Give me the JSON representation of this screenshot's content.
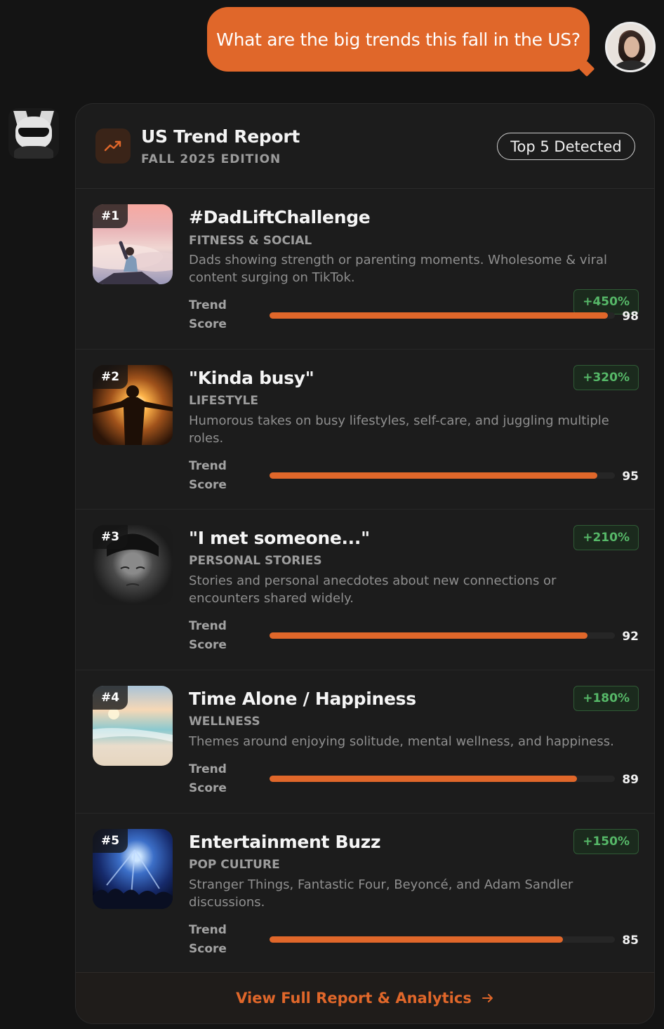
{
  "user_message": "What are the big trends this fall in the US?",
  "report": {
    "title": "US Trend Report",
    "subtitle": "FALL 2025 EDITION",
    "badge": "Top 5 Detected",
    "icon": "trending-up-icon",
    "accent_color": "#e0672a",
    "growth_color": "#56b868"
  },
  "trends": [
    {
      "rank": "#1",
      "title": "#DadLiftChallenge",
      "category": "FITNESS & SOCIAL",
      "description": "Dads showing strength or parenting moments. Wholesome & viral content surging on TikTok.",
      "growth": "+450%",
      "score_label_1": "Trend",
      "score_label_2": "Score",
      "score": "98"
    },
    {
      "rank": "#2",
      "title": "\"Kinda busy\"",
      "category": "LIFESTYLE",
      "description": "Humorous takes on busy lifestyles, self-care, and juggling multiple roles.",
      "growth": "+320%",
      "score_label_1": "Trend",
      "score_label_2": "Score",
      "score": "95"
    },
    {
      "rank": "#3",
      "title": "\"I met someone...\"",
      "category": "PERSONAL STORIES",
      "description": "Stories and personal anecdotes about new connections or encounters shared widely.",
      "growth": "+210%",
      "score_label_1": "Trend",
      "score_label_2": "Score",
      "score": "92"
    },
    {
      "rank": "#4",
      "title": "Time Alone / Happiness",
      "category": "WELLNESS",
      "description": "Themes around enjoying solitude, mental wellness, and happiness.",
      "growth": "+180%",
      "score_label_1": "Trend",
      "score_label_2": "Score",
      "score": "89"
    },
    {
      "rank": "#5",
      "title": "Entertainment Buzz",
      "category": "POP CULTURE",
      "description": "Stranger Things, Fantastic Four, Beyoncé, and Adam Sandler discussions.",
      "growth": "+150%",
      "score_label_1": "Trend",
      "score_label_2": "Score",
      "score": "85"
    }
  ],
  "footer": {
    "link_label": "View Full Report & Analytics",
    "icon": "arrow-right-icon"
  }
}
